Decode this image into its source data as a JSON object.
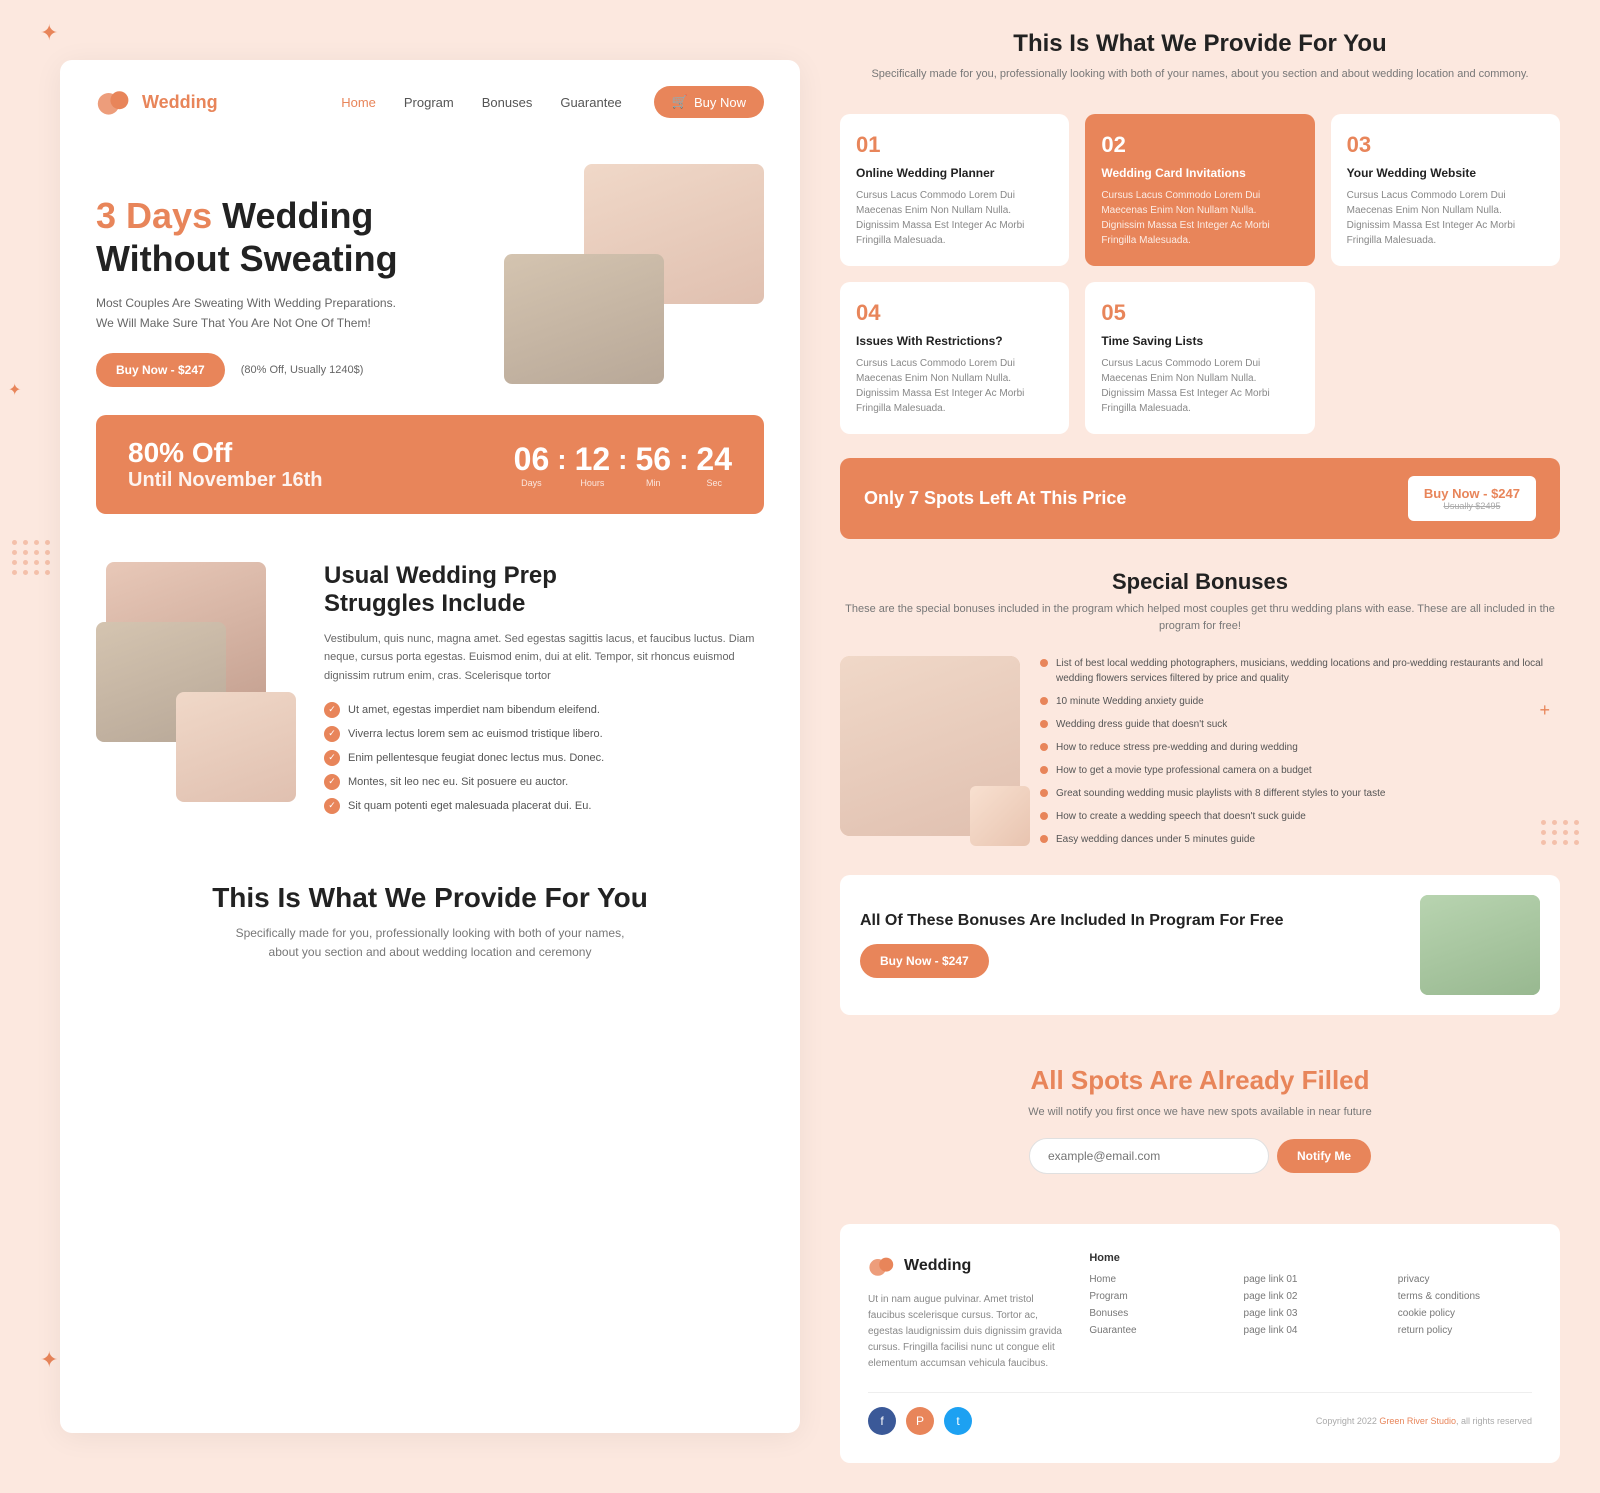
{
  "meta": {
    "title": "Wedding - 3 Days Wedding Without Sweating"
  },
  "decorative": {
    "star1": "✦",
    "star2": "✦",
    "plus1": "+",
    "plus2": "+"
  },
  "nav": {
    "logo_text": "Wedding",
    "links": [
      {
        "label": "Home",
        "active": true
      },
      {
        "label": "Program",
        "active": false
      },
      {
        "label": "Bonuses",
        "active": false
      },
      {
        "label": "Guarantee",
        "active": false
      }
    ],
    "cta_label": "Buy Now",
    "cta_icon": "🛒"
  },
  "hero": {
    "title_highlight": "3 Days",
    "title_rest": " Wedding\nWithout Sweating",
    "subtitle": "Most Couples Are Sweating With Wedding Preparations.\nWe Will Make Sure That You Are Not One Of Them!",
    "btn_label": "Buy Now - $247",
    "discount_text": "(80% Off, Usually 1240$)"
  },
  "countdown": {
    "title": "80% Off",
    "subtitle": "Until November 16th",
    "days_value": "06",
    "days_label": "Days",
    "hours_value": "12",
    "hours_label": "Hours",
    "mins_value": "56",
    "mins_label": "Min",
    "secs_value": "24",
    "secs_label": "Sec"
  },
  "struggles": {
    "title": "Usual Wedding Prep\nStruggles Include",
    "description": "Vestibulum, quis nunc, magna amet. Sed egestas sagittis lacus, et faucibus luctus. Diam neque, cursus porta egestas. Euismod enim, dui at elit. Tempor, sit rhoncus euismod dignissim rutrum enim, cras. Scelerisque tortor",
    "items": [
      "Ut amet, egestas imperdiet nam bibendum eleifend.",
      "Viverra lectus lorem sem ac euismod tristique libero.",
      "Enim pellentesque feugiat donec lectus mus. Donec.",
      "Montes, sit leo nec eu. Sit posuere eu auctor.",
      "Sit quam potenti eget malesuada placerat dui. Eu."
    ]
  },
  "provide_left": {
    "title": "This Is What We Provide For You",
    "subtitle": "Specifically made for you, professionally looking with both of your names,\nabout you section and about wedding location and ceremony"
  },
  "provide_right": {
    "title": "This Is What We Provide For You",
    "subtitle": "Specifically made for you, professionally looking with both of your names,\nabout you section and about wedding location and commony."
  },
  "features": [
    {
      "num": "01",
      "title": "Online Wedding Planner",
      "desc": "Cursus Lacus Commodo Lorem Dui Maecenas Enim Non Nullam Nulla. Dignissim Massa Est Integer Ac Morbi Fringilla Malesuada.",
      "highlighted": false
    },
    {
      "num": "02",
      "title": "Wedding Card Invitations",
      "desc": "Cursus Lacus Commodo Lorem Dui Maecenas Enim Non Nullam Nulla. Dignissim Massa Est Integer Ac Morbi Fringilla Malesuada.",
      "highlighted": true
    },
    {
      "num": "03",
      "title": "Your Wedding Website",
      "desc": "Cursus Lacus Commodo Lorem Dui Maecenas Enim Non Nullam Nulla. Dignissim Massa Est Integer Ac Morbi Fringilla Malesuada.",
      "highlighted": false
    },
    {
      "num": "04",
      "title": "Issues With Restrictions?",
      "desc": "Cursus Lacus Commodo Lorem Dui Maecenas Enim Non Nullam Nulla. Dignissim Massa Est Integer Ac Morbi Fringilla Malesuada.",
      "highlighted": false
    },
    {
      "num": "05",
      "title": "Time Saving Lists",
      "desc": "Cursus Lacus Commodo Lorem Dui Maecenas Enim Non Nullam Nulla. Dignissim Massa Est Integer Ac Morbi Fringilla Malesuada.",
      "highlighted": false
    }
  ],
  "spots_banner": {
    "text": "Only 7 Spots Left At This Price",
    "btn_label": "Buy Now - $247",
    "btn_cross": "Usually $2495"
  },
  "bonuses": {
    "title": "Special Bonuses",
    "subtitle": "These are the special bonuses included in the program which helped most couples get thru wedding plans with ease. These are all included in the program for free!",
    "items": [
      "List of best local wedding photographers, musicians, wedding locations and pro-wedding restaurants and local wedding flowers services filtered by price and quality",
      "10 minute Wedding anxiety guide",
      "Wedding dress guide that doesn't suck",
      "How to reduce stress pre-wedding and during wedding",
      "How to get a movie type professional camera on a budget",
      "Great sounding wedding music playlists with 8 different styles to your taste",
      "How to create a wedding speech that doesn't suck guide",
      "Easy wedding dances under 5 minutes guide"
    ]
  },
  "bonus_included": {
    "title": "All Of These Bonuses Are Included In Program For Free",
    "btn_label": "Buy Now - $247"
  },
  "spots_filled": {
    "title": "All Spots Are Already Filled",
    "subtitle": "We will notify you first once we have new spots available in near future",
    "input_placeholder": "example@email.com",
    "btn_label": "Notify Me"
  },
  "footer": {
    "brand": "Wedding",
    "brand_desc": "Ut in nam augue pulvinar. Amet tristol faucibus scelerisque cursus. Tortor ac, egestas laudignissim duis dignissim gravida cursus. Fringilla facilisi nunc ut congue elit elementum accumsan vehicula faucibus.",
    "col1_title": "Home",
    "col1_links": [
      "page link 01",
      "page link 02",
      "page link 03",
      "page link 04"
    ],
    "col2_title": null,
    "col2_links": [
      "privacy",
      "terms & conditions",
      "cookie policy",
      "return policy"
    ],
    "nav_links": [
      "Home",
      "Program",
      "Bonuses",
      "Guarantee"
    ],
    "copyright": "Copyright 2022 Green River Studio, all rights reserved"
  }
}
